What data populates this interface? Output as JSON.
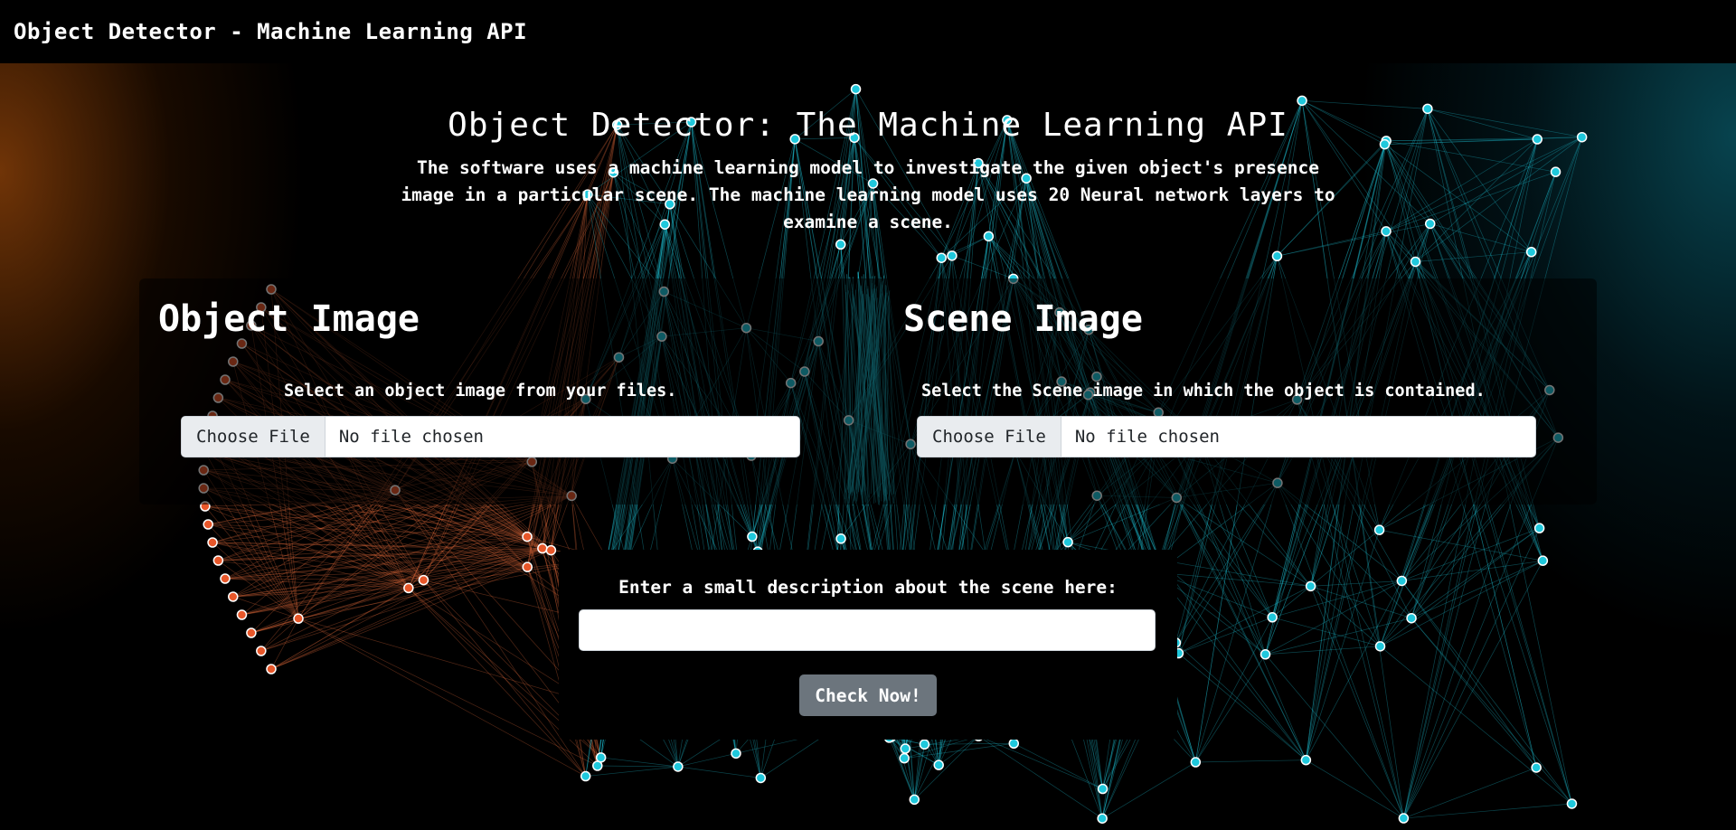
{
  "navbar": {
    "brand": "Object Detector - Machine Learning API"
  },
  "hero": {
    "title": "Object Detector: The Machine Learning API",
    "lead": "The software uses a machine learning model to investigate the given object's presence image in a particular scene. The machine learning model uses 20 Neural network layers to examine a scene."
  },
  "object_section": {
    "heading": "Object Image",
    "instruction": "Select an object image from your files.",
    "file_button": "Choose File",
    "file_status": "No file chosen"
  },
  "scene_section": {
    "heading": "Scene Image",
    "instruction": "Select the Scene image in which the object is contained.",
    "file_button": "Choose File",
    "file_status": "No file chosen"
  },
  "description_section": {
    "label": "Enter a small description about the scene here:",
    "input_value": "",
    "submit_label": "Check Now!"
  },
  "colors": {
    "node_cyan": "#1fc8dc",
    "node_orange": "#e8572a",
    "button_gray": "#6c757d"
  }
}
